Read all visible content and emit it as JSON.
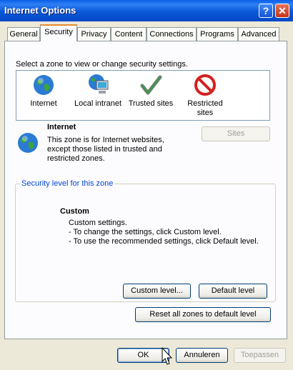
{
  "window": {
    "title": "Internet Options"
  },
  "tabs": [
    "General",
    "Security",
    "Privacy",
    "Content",
    "Connections",
    "Programs",
    "Advanced"
  ],
  "active_tab": "Security",
  "instruction": "Select a zone to view or change security settings.",
  "zones": [
    {
      "label": "Internet",
      "icon": "globe-icon"
    },
    {
      "label": "Local intranet",
      "icon": "intranet-icon"
    },
    {
      "label": "Trusted sites",
      "icon": "checkmark-icon"
    },
    {
      "label_line1": "Restricted",
      "label_line2": "sites",
      "icon": "restricted-icon"
    }
  ],
  "selected_zone": {
    "name": "Internet",
    "description_lines": [
      "This zone is for Internet websites,",
      "except those listed in trusted and",
      "restricted zones."
    ]
  },
  "sites_button": "Sites",
  "security_group": {
    "legend": "Security level for this zone",
    "level_title": "Custom",
    "lines": [
      "Custom settings.",
      "- To change the settings, click Custom level.",
      "- To use the recommended settings, click Default level."
    ]
  },
  "buttons": {
    "custom_level": "Custom level...",
    "default_level": "Default level",
    "reset_all": "Reset all zones to default level",
    "ok": "OK",
    "cancel": "Annuleren",
    "apply": "Toepassen"
  },
  "colors": {
    "titlebar": "#0a5fe6",
    "accent_tab": "#e68b2c",
    "legend_text": "#0046d5"
  }
}
